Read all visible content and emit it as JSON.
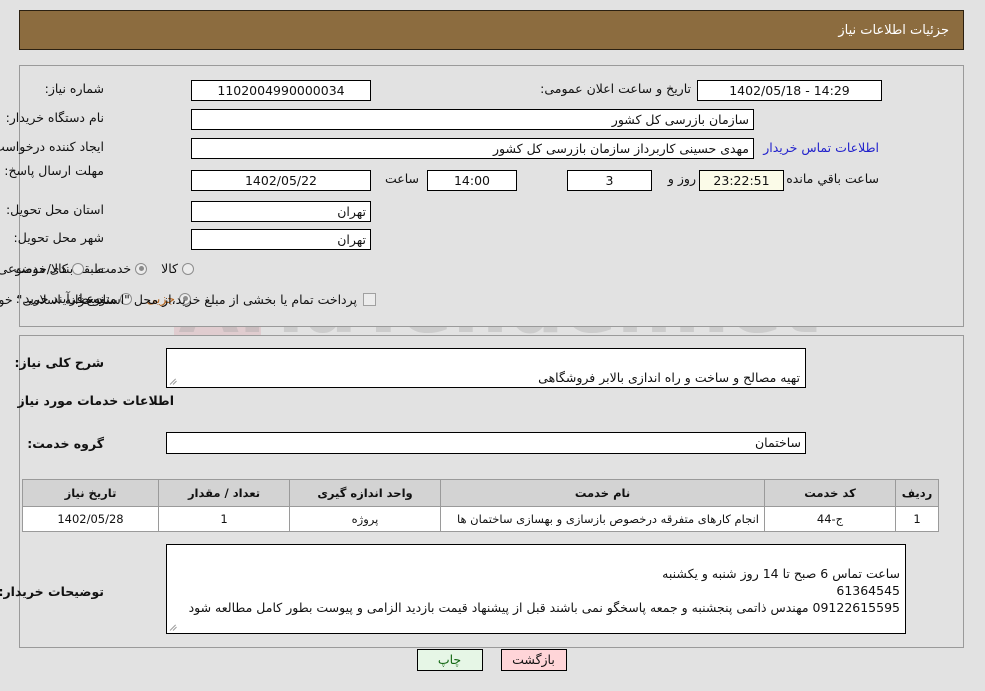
{
  "header": {
    "title": "جزئیات اطلاعات نیاز"
  },
  "form": {
    "need_number_label": "شماره نیاز:",
    "need_number_value": "1102004990000034",
    "announce_label": "تاریخ و ساعت اعلان عمومی:",
    "announce_value": "14:29 - 1402/05/18",
    "buyer_org_label": "نام دستگاه خریدار:",
    "buyer_org_value": "سازمان بازرسی کل کشور",
    "creator_label": "ایجاد کننده درخواست:",
    "creator_value": "مهدی حسینی کاربرداز سازمان بازرسی کل کشور",
    "buyer_contact_link": "اطلاعات تماس خریدار",
    "deadline_label": "مهلت ارسال پاسخ: تا تاریخ:",
    "deadline_date": "1402/05/22",
    "deadline_hour_label": "ساعت",
    "deadline_hour_value": "14:00",
    "remaining_days": "3",
    "remaining_days_label": "روز و",
    "remaining_time": "23:22:51",
    "remaining_time_label": "ساعت باقي مانده",
    "province_label": "استان محل تحویل:",
    "province_value": "تهران",
    "city_label": "شهر محل تحویل:",
    "city_value": "تهران",
    "category_label": "طبقه بندی موضوعی:",
    "category_options": [
      "کالا",
      "خدمت",
      "کالا/خدمت"
    ],
    "category_selected_index": 1,
    "process_label": "نوع فرآیند خرید :",
    "process_options": [
      "جزیی",
      "متوسط"
    ],
    "process_selected_index": 0,
    "islamic_treasury_checkbox_label": "پرداخت تمام یا بخشی از مبلغ خرید،از محل \"اسناد خزانه اسلامی\" خواهد بود.",
    "islamic_treasury_checked": false
  },
  "details": {
    "general_desc_label": "شرح کلی نیاز:",
    "general_desc_value": "تهیه مصالح و ساخت و راه اندازی بالابر فروشگاهی",
    "services_section_title": "اطلاعات خدمات مورد نیاز",
    "service_group_label": "گروه خدمت:",
    "service_group_value": "ساختمان"
  },
  "table": {
    "columns": [
      "ردیف",
      "کد خدمت",
      "نام خدمت",
      "واحد اندازه گیری",
      "تعداد / مقدار",
      "تاریخ نیاز"
    ],
    "rows": [
      {
        "row_no": "1",
        "service_code": "ج-44",
        "service_name": "انجام کارهای متفرقه درخصوص بازسازی و بهسازی ساختمان ها",
        "unit": "پروژه",
        "quantity": "1",
        "need_date": "1402/05/28"
      }
    ]
  },
  "buyer_notes": {
    "label": "توضیحات خریدار:",
    "value": "ساعت تماس 6 صبح تا 14 روز شنبه و یکشنبه\n61364545\n09122615595   مهندس ذاتمی پنجشنبه و جمعه پاسخگو نمی باشند  قبل از پیشنهاد قیمت بازدید الزامی و پیوست بطور کامل مطالعه شود"
  },
  "buttons": {
    "print_label": "چاپ",
    "back_label": "بازگشت"
  },
  "watermark": {
    "text": "AriaTender.net"
  },
  "colors": {
    "header_bg": "#8c6c3f",
    "link": "#2222cc",
    "timer_bg": "#fbfbe8",
    "print_bg": "#e6f6e6",
    "back_bg": "#ffd5d8",
    "selected_radio_text": "#b5651d"
  }
}
